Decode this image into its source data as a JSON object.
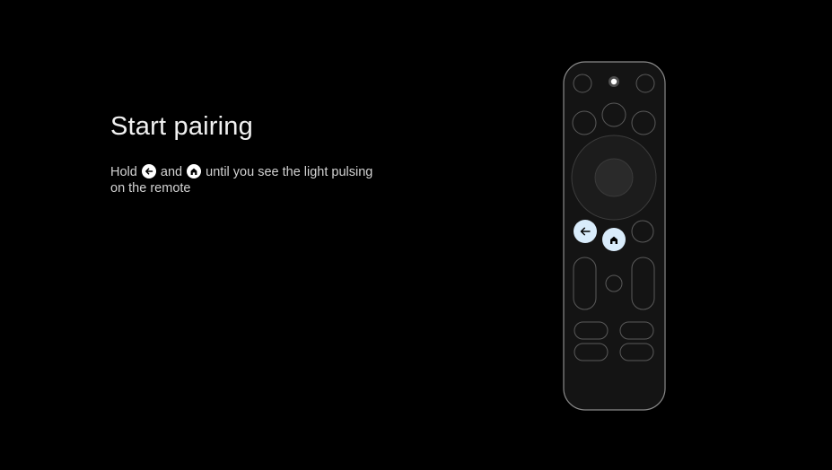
{
  "pairing": {
    "title": "Start pairing",
    "instruction_prefix": "Hold",
    "instruction_and": "and",
    "instruction_suffix": "until you see the light pulsing on the remote"
  },
  "icons": {
    "back": "arrow-left-icon",
    "home": "home-icon"
  },
  "colors": {
    "background": "#000000",
    "highlight": "#d9ecfb",
    "remote_body": "#141414",
    "outline": "#5a5a5a"
  }
}
